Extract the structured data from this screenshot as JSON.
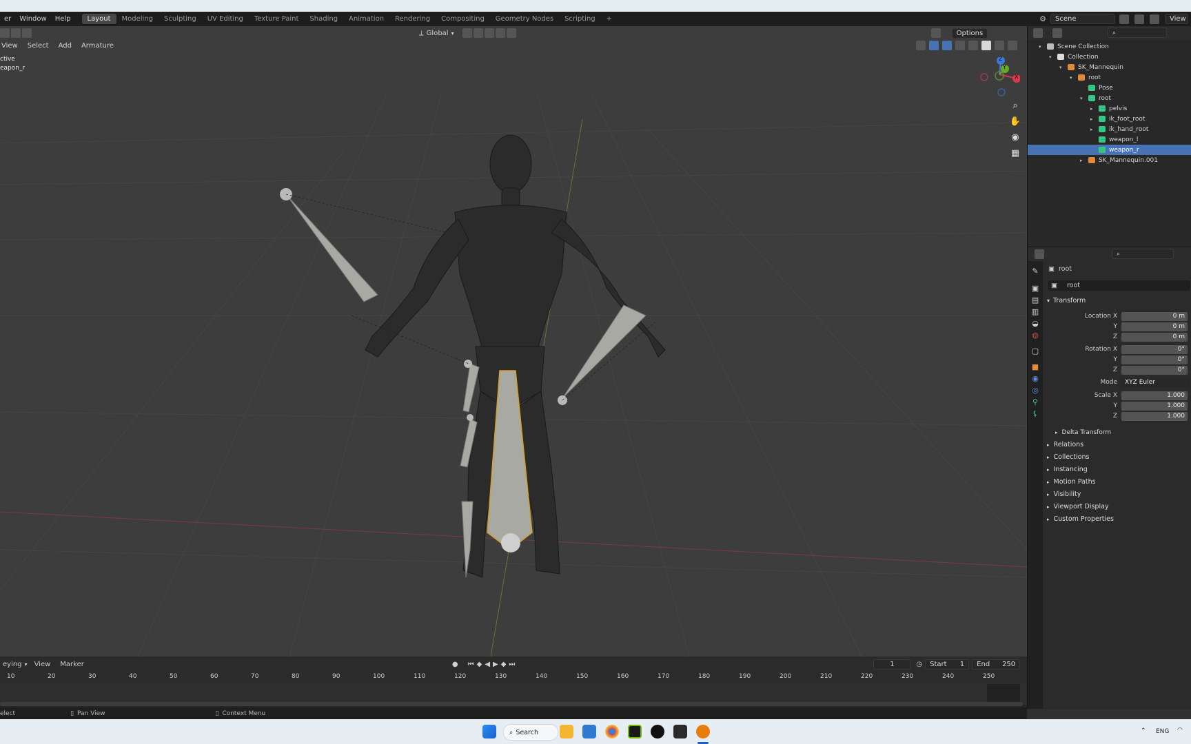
{
  "menubar": {
    "items": [
      "er",
      "Window",
      "Help"
    ],
    "workspaces": [
      "Layout",
      "Modeling",
      "Sculpting",
      "UV Editing",
      "Texture Paint",
      "Shading",
      "Animation",
      "Rendering",
      "Compositing",
      "Geometry Nodes",
      "Scripting"
    ],
    "add_tab": "+",
    "scene_label": "Scene",
    "view_layer_label": "View"
  },
  "viewport": {
    "orientation": "Global",
    "options_label": "Options",
    "menu": [
      "View",
      "Select",
      "Add",
      "Armature"
    ],
    "overlay_text_1": "ctive",
    "overlay_text_2": "eapon_r"
  },
  "gizmo": {
    "x": "X",
    "y": "Y",
    "z": "Z"
  },
  "timeline": {
    "menu": [
      "eying",
      "View",
      "Marker"
    ],
    "current_frame": "1",
    "start_label": "Start",
    "start_value": "1",
    "end_label": "End",
    "end_value": "250",
    "ticks": [
      "10",
      "20",
      "30",
      "40",
      "50",
      "60",
      "70",
      "80",
      "90",
      "100",
      "110",
      "120",
      "130",
      "140",
      "150",
      "160",
      "170",
      "180",
      "190",
      "200",
      "210",
      "220",
      "230",
      "240",
      "250"
    ]
  },
  "statusbar": {
    "select": "elect",
    "pan": "Pan View",
    "context": "Context Menu"
  },
  "outliner": {
    "items": [
      {
        "label": "Scene Collection",
        "depth": 0,
        "icon": "scene-collection-icon"
      },
      {
        "label": "Collection",
        "depth": 1,
        "icon": "collection-icon"
      },
      {
        "label": "SK_Mannequin",
        "depth": 2,
        "icon": "armature-icon"
      },
      {
        "label": "root",
        "depth": 3,
        "icon": "armature-data-icon"
      },
      {
        "label": "Pose",
        "depth": 4,
        "icon": "pose-icon"
      },
      {
        "label": "root",
        "depth": 4,
        "icon": "bone-icon"
      },
      {
        "label": "pelvis",
        "depth": 5,
        "icon": "bone-icon"
      },
      {
        "label": "ik_foot_root",
        "depth": 5,
        "icon": "bone-icon"
      },
      {
        "label": "ik_hand_root",
        "depth": 5,
        "icon": "bone-icon"
      },
      {
        "label": "weapon_l",
        "depth": 5,
        "icon": "bone-icon"
      },
      {
        "label": "weapon_r",
        "depth": 5,
        "icon": "bone-icon",
        "selected": true
      },
      {
        "label": "SK_Mannequin.001",
        "depth": 4,
        "icon": "mesh-icon"
      }
    ]
  },
  "properties": {
    "object_name": "root",
    "data_name": "root",
    "transform_title": "Transform",
    "location_label": "Location X",
    "rotation_label": "Rotation X",
    "scale_label": "Scale X",
    "y_label": "Y",
    "z_label": "Z",
    "mode_label": "Mode",
    "mode_value": "XYZ Euler",
    "location": [
      "0 m",
      "0 m",
      "0 m"
    ],
    "rotation": [
      "0°",
      "0°",
      "0°"
    ],
    "scale": [
      "1.000",
      "1.000",
      "1.000"
    ],
    "delta_transform": "Delta Transform",
    "panels": [
      "Relations",
      "Collections",
      "Instancing",
      "Motion Paths",
      "Visibility",
      "Viewport Display",
      "Custom Properties"
    ]
  },
  "taskbar": {
    "search": "Search",
    "lang": "ENG"
  },
  "colors": {
    "accent": "#4772b3",
    "x_axis": "#d8374e",
    "y_axis": "#6aa82c",
    "z_axis": "#3b7ad8",
    "bone_green": "#35c585"
  }
}
